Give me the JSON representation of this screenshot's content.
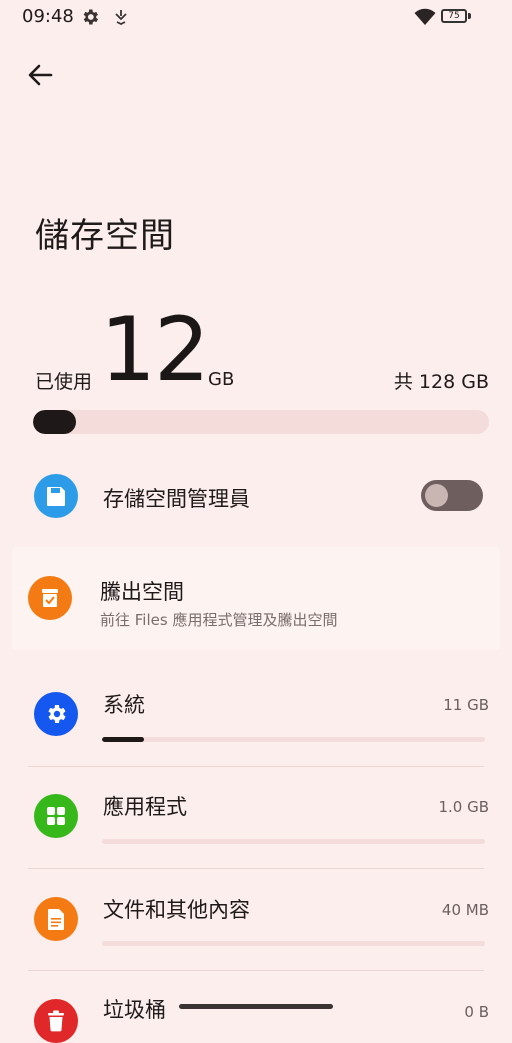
{
  "status_bar": {
    "time": "09:48",
    "battery": "75"
  },
  "page": {
    "title": "儲存空間"
  },
  "usage": {
    "used_label": "已使用",
    "used_value": "12",
    "used_unit": "GB",
    "total": "共 128 GB",
    "used_fraction": 0.094
  },
  "storage_manager": {
    "label": "存儲空間管理員",
    "enabled": false
  },
  "free_up": {
    "title": "騰出空間",
    "subtitle": "前往 Files 應用程式管理及騰出空間"
  },
  "categories": [
    {
      "name": "系統",
      "size": "11 GB",
      "fraction": 0.11,
      "color": "#1458f0"
    },
    {
      "name": "應用程式",
      "size": "1.0 GB",
      "fraction": 0.0,
      "color": "#36b81a"
    },
    {
      "name": "文件和其他內容",
      "size": "40 MB",
      "fraction": 0.0,
      "color": "#f47a13"
    },
    {
      "name": "垃圾桶",
      "size": "0 B",
      "fraction": 0.0,
      "color": "#e0282a"
    }
  ],
  "icons": {
    "status": [
      "gear-icon",
      "navigation-icon",
      "wifi-icon",
      "battery-icon"
    ],
    "back": "arrow-left-icon",
    "manager": "sd-card-icon",
    "free_up": "cleanup-icon",
    "system": "gear-icon",
    "apps": "apps-grid-icon",
    "docs": "document-icon",
    "trash": "trash-icon"
  }
}
